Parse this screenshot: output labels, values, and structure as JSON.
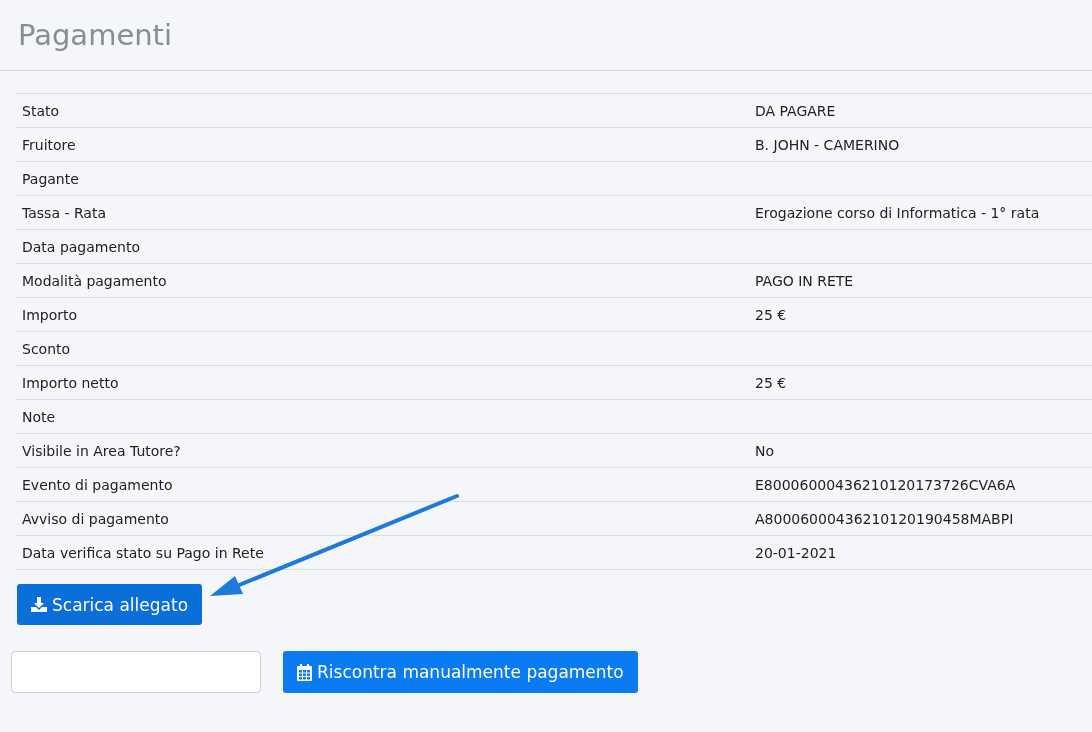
{
  "page_title": "Pagamenti",
  "rows": [
    {
      "label": "Stato",
      "value": "DA PAGARE"
    },
    {
      "label": "Fruitore",
      "value": "B. JOHN - CAMERINO"
    },
    {
      "label": "Pagante"
    },
    {
      "label": "Tassa - Rata",
      "value": "Erogazione corso di Informatica - 1° rata"
    },
    {
      "label": "Data pagamento"
    },
    {
      "label": "Modalità pagamento",
      "value": "PAGO IN RETE"
    },
    {
      "label": "Importo",
      "value": "25 €"
    },
    {
      "label": "Sconto"
    },
    {
      "label": "Importo netto",
      "value": "25 €"
    },
    {
      "label": "Note"
    },
    {
      "label": "Visibile in Area Tutore?",
      "value": "No"
    },
    {
      "label": "Evento di pagamento",
      "value": "E80006000436210120173726CVA6A"
    },
    {
      "label": "Avviso di pagamento",
      "value": "A80006000436210120190458MABPI"
    },
    {
      "label": "Data verifica stato su Pago in Rete",
      "value": "20-01-2021"
    }
  ],
  "download_button": "Scarica allegato",
  "reconcile_button": "Riscontra manualmente pagamento"
}
